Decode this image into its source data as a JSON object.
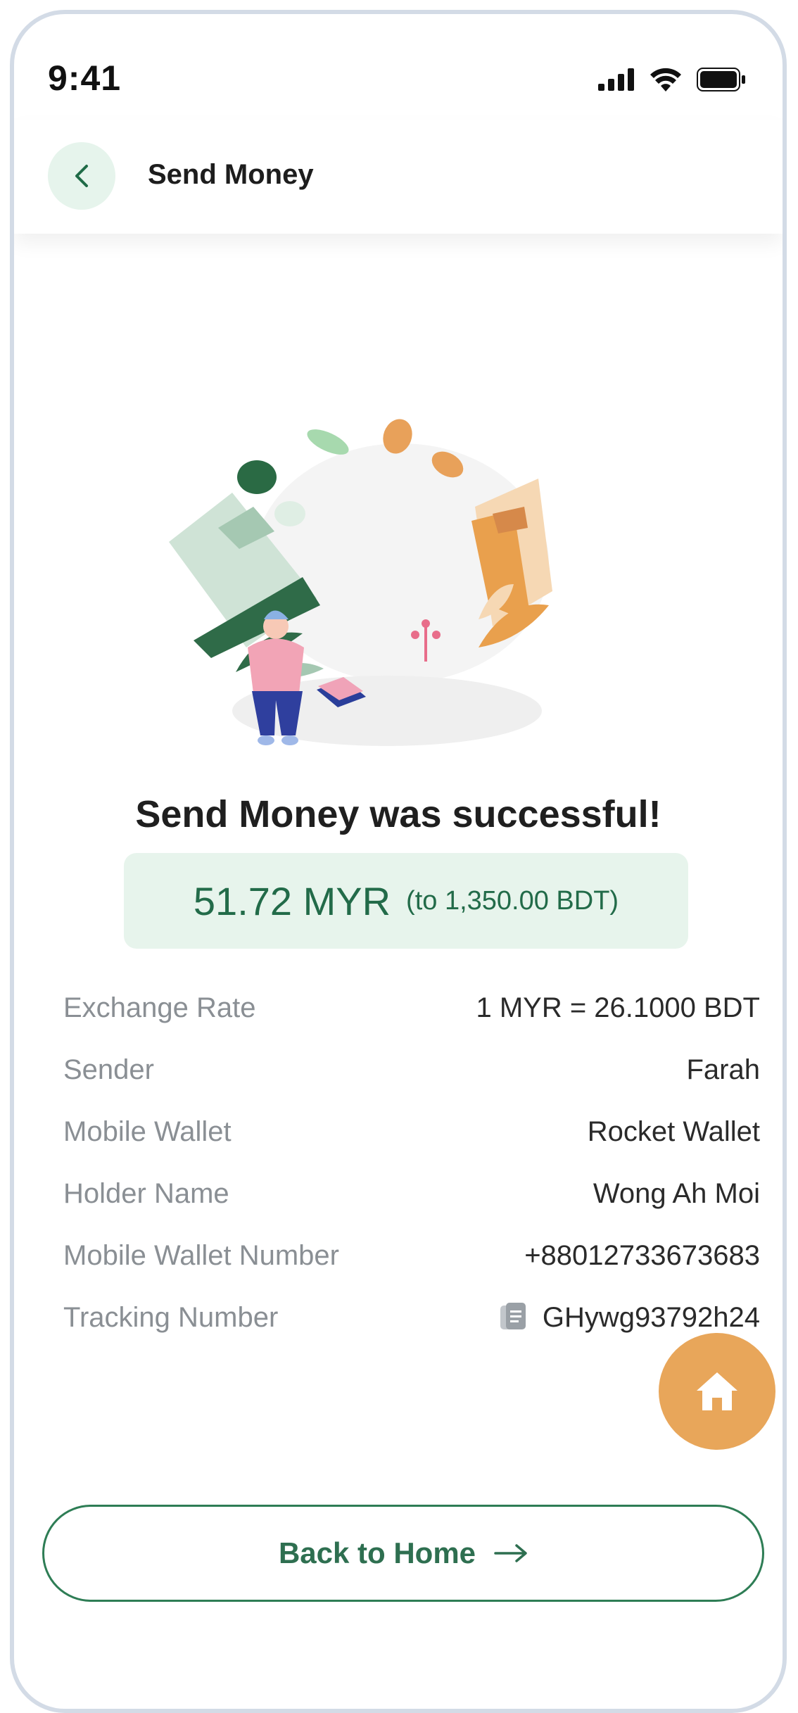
{
  "status_bar": {
    "time": "9:41",
    "icons": [
      "signal-icon",
      "wifi-icon",
      "battery-icon"
    ]
  },
  "header": {
    "back_icon": "chevron-left-icon",
    "title": "Send Money"
  },
  "illustration": {
    "subject": "money-transfer-illustration"
  },
  "result": {
    "title": "Send Money was successful!",
    "amount": "51.72 MYR",
    "converted": "(to 1,350.00 BDT)"
  },
  "details": [
    {
      "label": "Exchange Rate",
      "value": "1 MYR = 26.1000 BDT"
    },
    {
      "label": "Sender",
      "value": "Farah"
    },
    {
      "label": "Mobile Wallet",
      "value": "Rocket Wallet"
    },
    {
      "label": "Holder Name",
      "value": "Wong Ah Moi"
    },
    {
      "label": "Mobile Wallet Number",
      "value": "+88012733673683"
    },
    {
      "label": "Tracking Number",
      "value": "GHywg93792h24",
      "icon": "copy-icon"
    }
  ],
  "fab": {
    "icon": "home-icon"
  },
  "footer": {
    "button_label": "Back to Home",
    "button_icon": "arrow-right-icon"
  },
  "colors": {
    "primary_green": "#2e7d55",
    "light_green": "#e7f4ec",
    "accent_orange": "#e8a65a"
  }
}
